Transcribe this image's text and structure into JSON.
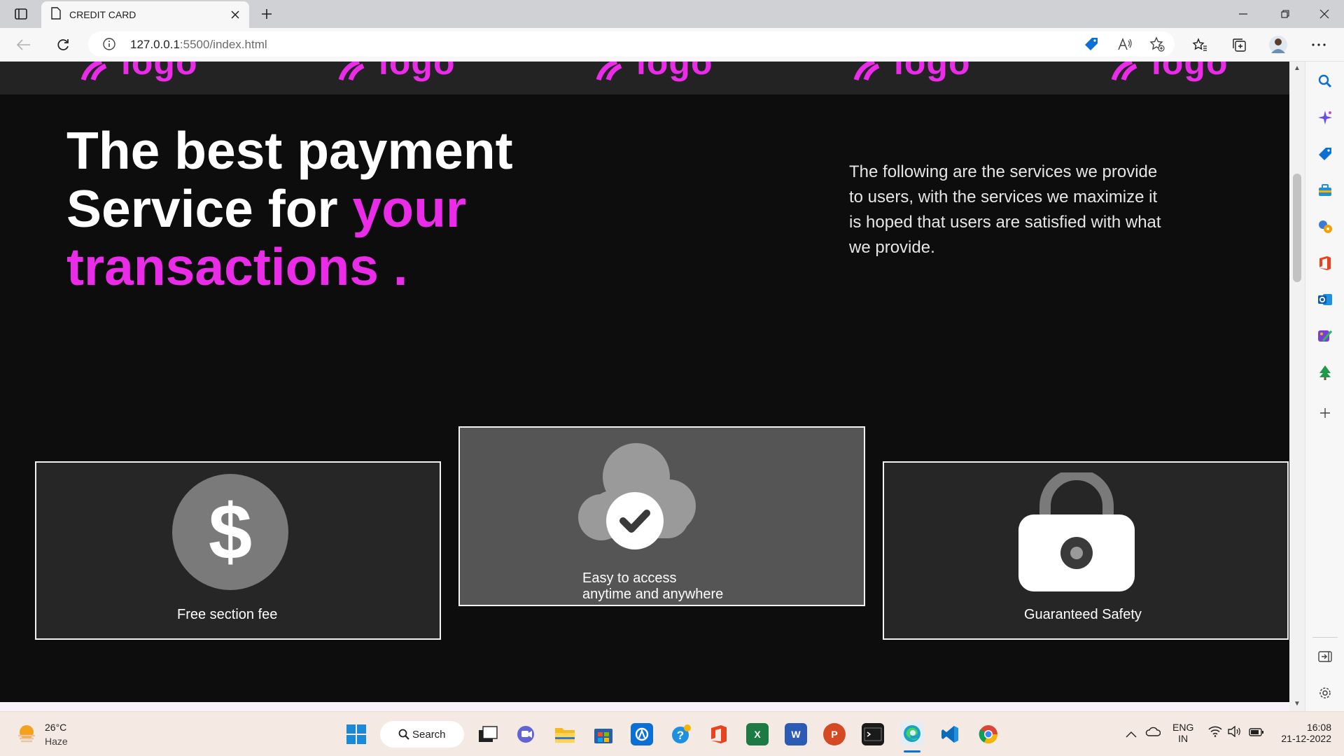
{
  "browser": {
    "tab_title": "CREDIT CARD",
    "url_host": "127.0.0.1",
    "url_path": ":5500/index.html"
  },
  "page": {
    "logo_text": "logo",
    "hero": {
      "line1": "The best payment",
      "line2_plain": "Service for ",
      "line2_accent": "your",
      "line3_accent": "transactions ."
    },
    "description": "The following are the services we provide to users, with the services we maximize it is hoped that users are satisfied with what we provide.",
    "cards": [
      {
        "icon": "dollar-icon",
        "label": "Free section fee"
      },
      {
        "icon": "cloud-check-icon",
        "label_line1": "Easy to access",
        "label_line2": "anytime and anywhere"
      },
      {
        "icon": "lock-icon",
        "label": "Guaranteed Safety"
      }
    ],
    "colors": {
      "accent": "#ea2ce8",
      "background": "#0d0d0d"
    }
  },
  "taskbar": {
    "weather_temp": "26°C",
    "weather_cond": "Haze",
    "search_label": "Search",
    "lang_line1": "ENG",
    "lang_line2": "IN",
    "time": "16:08",
    "date": "21-12-2022"
  }
}
